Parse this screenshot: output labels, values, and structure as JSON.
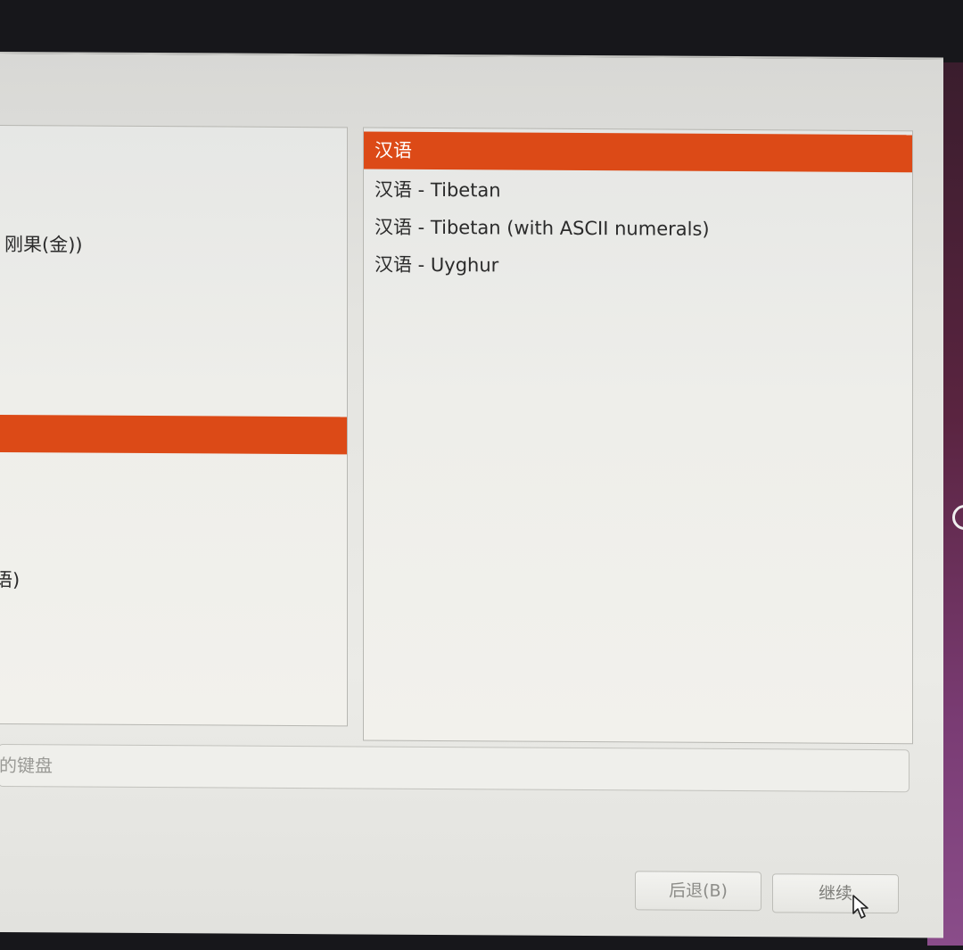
{
  "layout_list": {
    "items": [
      {
        "label": "刚果(金))",
        "selected": false
      },
      {
        "label": "",
        "selected": true
      },
      {
        "label": "语)",
        "selected": false
      }
    ]
  },
  "variant_list": {
    "items": [
      {
        "label": "汉语",
        "selected": true
      },
      {
        "label": "汉语 - Tibetan",
        "selected": false
      },
      {
        "label": "汉语 - Tibetan (with ASCII numerals)",
        "selected": false
      },
      {
        "label": "汉语 - Uyghur",
        "selected": false
      }
    ]
  },
  "keyboard_test": {
    "placeholder": "的键盘"
  },
  "buttons": {
    "back": "后退(B)",
    "continue": "继续"
  },
  "colors": {
    "selection": "#dc4a17",
    "desktop_accent": "#7a3c74"
  },
  "icons": {
    "cursor": "mouse-pointer-icon"
  }
}
